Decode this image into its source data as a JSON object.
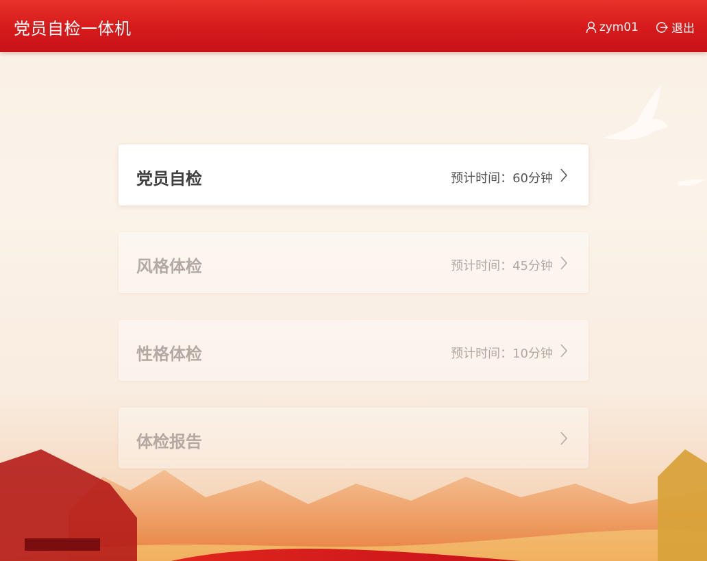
{
  "header": {
    "title": "党员自检一体机",
    "username": "zym01",
    "logout_label": "退出"
  },
  "menu": {
    "items": [
      {
        "label": "党员自检",
        "time": "预计时间：60分钟",
        "active": true
      },
      {
        "label": "风格体检",
        "time": "预计时间：45分钟",
        "active": false
      },
      {
        "label": "性格体检",
        "time": "预计时间：10分钟",
        "active": false
      },
      {
        "label": "体检报告",
        "time": "",
        "active": false
      }
    ]
  },
  "colors": {
    "header_red": "#d61a1b",
    "active_text": "#3e3e3e",
    "inactive_text": "#b3a9a2"
  },
  "icons": {
    "user": "user-icon",
    "logout": "logout-icon",
    "chevron": "chevron-right-icon"
  }
}
